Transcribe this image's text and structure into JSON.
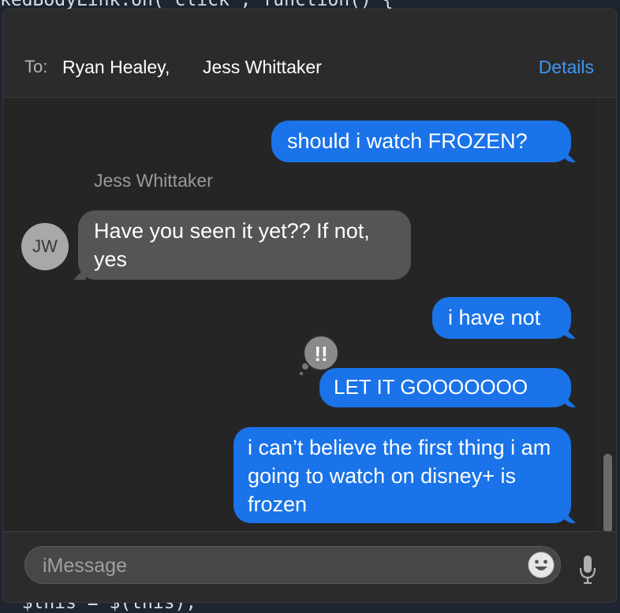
{
  "background_code": {
    "top_line": "kedBodyLink.on('click', function() {",
    "bottom_line": "  $this = $(this);"
  },
  "header": {
    "to_label": "To:",
    "recipients": [
      "Ryan Healey,",
      "Jess Whittaker"
    ],
    "details_label": "Details"
  },
  "messages": [
    {
      "direction": "sent",
      "text": "should i watch FROZEN?"
    },
    {
      "direction": "received",
      "sender": "Jess Whittaker",
      "text": "Have you seen it yet?? If not, yes"
    },
    {
      "direction": "sent",
      "text": "i have not"
    },
    {
      "direction": "sent",
      "text": "LET IT GOOOOOOO",
      "tapback": "!!"
    },
    {
      "direction": "sent",
      "text": "i can’t believe the first thing i am going to watch on disney+ is frozen"
    }
  ],
  "avatar": {
    "initials": "JW"
  },
  "composer": {
    "placeholder": "iMessage",
    "emoji_icon": "smiley-icon",
    "mic_icon": "microphone-icon"
  },
  "colors": {
    "sent_bubble": "#1a73e8",
    "received_bubble": "#555558",
    "accent": "#3d96f2"
  }
}
